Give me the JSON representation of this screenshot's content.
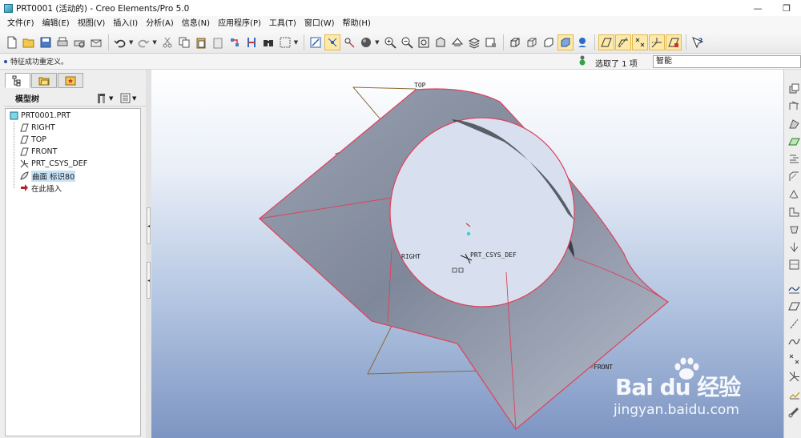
{
  "window": {
    "title": "PRT0001 (活动的) - Creo Elements/Pro 5.0",
    "minimize": "—",
    "restore": "❐"
  },
  "menu": [
    "文件(F)",
    "编辑(E)",
    "视图(V)",
    "插入(I)",
    "分析(A)",
    "信息(N)",
    "应用程序(P)",
    "工具(T)",
    "窗口(W)",
    "帮助(H)"
  ],
  "message": {
    "text": "特征成功重定义。",
    "selection": "选取了 1 项",
    "filter": "智能"
  },
  "model_tree": {
    "header": "模型树",
    "items": [
      {
        "label": "PRT0001.PRT",
        "icon": "part-icon"
      },
      {
        "label": "RIGHT",
        "icon": "datum-plane-icon"
      },
      {
        "label": "TOP",
        "icon": "datum-plane-icon"
      },
      {
        "label": "FRONT",
        "icon": "datum-plane-icon"
      },
      {
        "label": "PRT_CSYS_DEF",
        "icon": "csys-icon"
      },
      {
        "label": "曲面 标识80",
        "icon": "surface-icon"
      },
      {
        "label": "在此插入",
        "icon": "insert-here-arrow-icon"
      }
    ]
  },
  "viewport": {
    "labels": {
      "top": "TOP",
      "right": "RIGHT",
      "front": "FRONT",
      "csys": "PRT_CSYS_DEF"
    },
    "colors": {
      "surface": "#8a94a6",
      "edge": "#e0405a",
      "datum": "#8a6a3a"
    }
  },
  "watermark": {
    "brand": "Bai du 经验",
    "site": "jingyan.baidu.com"
  }
}
